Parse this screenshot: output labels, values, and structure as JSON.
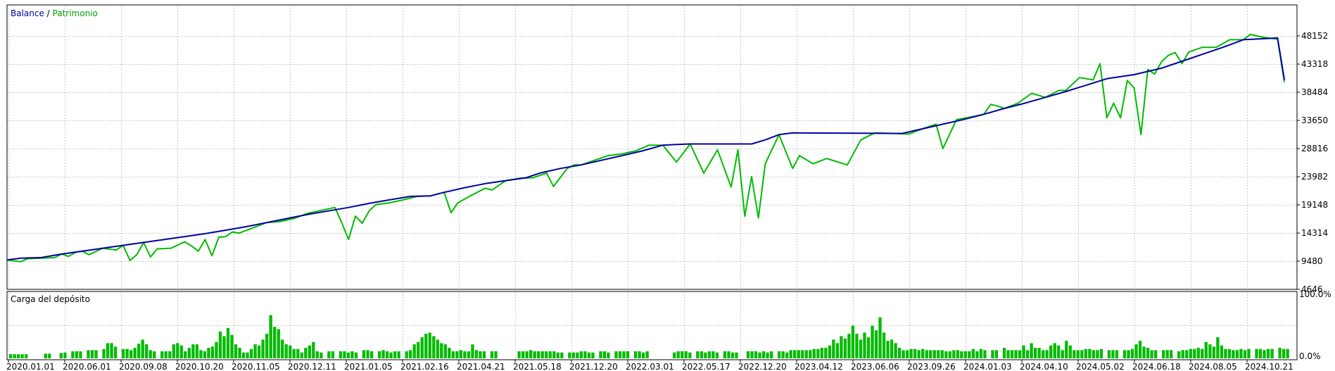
{
  "colors": {
    "balance": "#0000A0",
    "equity": "#00BB00",
    "bars": "#00BB00",
    "grid": "#C8C8C8",
    "frame": "#000000"
  },
  "legend": {
    "balance": "Balance",
    "separator": " / ",
    "equity": "Patrimonio"
  },
  "subchart": {
    "title": "Carga del depósito"
  },
  "chart_data": [
    {
      "type": "line",
      "grid": true,
      "y_ticks": [
        "48152",
        "43318",
        "38484",
        "33650",
        "28816",
        "23982",
        "19148",
        "14314",
        "9480",
        "4646"
      ],
      "ylim": [
        4646,
        48152
      ],
      "series": [
        {
          "name": "Balance",
          "color": "#0000A0",
          "values": [
            [
              0,
              9700
            ],
            [
              4,
              10000
            ],
            [
              10,
              10100
            ],
            [
              16,
              10700
            ],
            [
              22,
              11200
            ],
            [
              28,
              11700
            ],
            [
              34,
              12200
            ],
            [
              40,
              12700
            ],
            [
              46,
              13200
            ],
            [
              52,
              13700
            ],
            [
              58,
              14200
            ],
            [
              64,
              14800
            ],
            [
              70,
              15400
            ],
            [
              76,
              16100
            ],
            [
              82,
              16800
            ],
            [
              88,
              17500
            ],
            [
              94,
              18100
            ],
            [
              100,
              18700
            ],
            [
              106,
              19400
            ],
            [
              112,
              20000
            ],
            [
              118,
              20600
            ],
            [
              124,
              20700
            ],
            [
              128,
              21300
            ],
            [
              134,
              22100
            ],
            [
              140,
              22800
            ],
            [
              146,
              23300
            ],
            [
              152,
              23800
            ],
            [
              156,
              24600
            ],
            [
              162,
              25400
            ],
            [
              168,
              26000
            ],
            [
              174,
              26800
            ],
            [
              180,
              27600
            ],
            [
              186,
              28400
            ],
            [
              192,
              29400
            ],
            [
              196,
              29500
            ],
            [
              200,
              29600
            ],
            [
              218,
              29600
            ],
            [
              222,
              30300
            ],
            [
              226,
              31200
            ],
            [
              230,
              31500
            ],
            [
              262,
              31400
            ],
            [
              268,
              32200
            ],
            [
              274,
              33000
            ],
            [
              280,
              33800
            ],
            [
              286,
              34700
            ],
            [
              292,
              35700
            ],
            [
              298,
              36600
            ],
            [
              304,
              37600
            ],
            [
              310,
              38600
            ],
            [
              316,
              39700
            ],
            [
              322,
              40800
            ],
            [
              330,
              41500
            ],
            [
              338,
              42600
            ],
            [
              344,
              43800
            ],
            [
              350,
              45000
            ],
            [
              356,
              46200
            ],
            [
              362,
              47500
            ],
            [
              372,
              47800
            ],
            [
              374,
              40600
            ]
          ]
        },
        {
          "name": "Patrimonio",
          "color": "#00BB00",
          "values": [
            [
              0,
              9700
            ],
            [
              4,
              9400
            ],
            [
              6,
              9900
            ],
            [
              10,
              10000
            ],
            [
              14,
              10100
            ],
            [
              16,
              10700
            ],
            [
              18,
              10300
            ],
            [
              20,
              11000
            ],
            [
              22,
              11200
            ],
            [
              24,
              10600
            ],
            [
              28,
              11700
            ],
            [
              32,
              11400
            ],
            [
              34,
              12200
            ],
            [
              36,
              9600
            ],
            [
              38,
              10600
            ],
            [
              40,
              12700
            ],
            [
              42,
              10200
            ],
            [
              44,
              11600
            ],
            [
              48,
              11700
            ],
            [
              52,
              12800
            ],
            [
              54,
              12100
            ],
            [
              56,
              11200
            ],
            [
              58,
              13200
            ],
            [
              60,
              10400
            ],
            [
              62,
              13600
            ],
            [
              64,
              13700
            ],
            [
              66,
              14500
            ],
            [
              68,
              14300
            ],
            [
              72,
              15200
            ],
            [
              76,
              16100
            ],
            [
              80,
              16300
            ],
            [
              84,
              16800
            ],
            [
              88,
              17700
            ],
            [
              92,
              18200
            ],
            [
              96,
              18700
            ],
            [
              98,
              16100
            ],
            [
              100,
              13200
            ],
            [
              102,
              17200
            ],
            [
              104,
              16000
            ],
            [
              106,
              18100
            ],
            [
              108,
              19200
            ],
            [
              112,
              19500
            ],
            [
              116,
              20000
            ],
            [
              120,
              20600
            ],
            [
              124,
              20700
            ],
            [
              128,
              21300
            ],
            [
              130,
              17800
            ],
            [
              132,
              19500
            ],
            [
              136,
              20800
            ],
            [
              140,
              22000
            ],
            [
              142,
              21700
            ],
            [
              146,
              23300
            ],
            [
              150,
              23700
            ],
            [
              154,
              23800
            ],
            [
              158,
              24600
            ],
            [
              160,
              22300
            ],
            [
              164,
              25400
            ],
            [
              166,
              26000
            ],
            [
              168,
              26000
            ],
            [
              172,
              26800
            ],
            [
              176,
              27600
            ],
            [
              180,
              27900
            ],
            [
              184,
              28400
            ],
            [
              188,
              29400
            ],
            [
              192,
              29400
            ],
            [
              196,
              26500
            ],
            [
              200,
              29600
            ],
            [
              204,
              24600
            ],
            [
              208,
              28600
            ],
            [
              212,
              22200
            ],
            [
              214,
              28600
            ],
            [
              216,
              17200
            ],
            [
              218,
              24000
            ],
            [
              220,
              16900
            ],
            [
              222,
              26200
            ],
            [
              226,
              31200
            ],
            [
              230,
              25400
            ],
            [
              232,
              27600
            ],
            [
              236,
              26200
            ],
            [
              240,
              27100
            ],
            [
              246,
              26000
            ],
            [
              250,
              30300
            ],
            [
              254,
              31500
            ],
            [
              260,
              31400
            ],
            [
              264,
              31300
            ],
            [
              268,
              32200
            ],
            [
              272,
              33000
            ],
            [
              274,
              28800
            ],
            [
              278,
              33800
            ],
            [
              282,
              34200
            ],
            [
              286,
              34700
            ],
            [
              288,
              36400
            ],
            [
              290,
              36100
            ],
            [
              292,
              35700
            ],
            [
              296,
              36600
            ],
            [
              300,
              38300
            ],
            [
              304,
              37600
            ],
            [
              308,
              38800
            ],
            [
              310,
              38800
            ],
            [
              314,
              41000
            ],
            [
              318,
              40600
            ],
            [
              320,
              43400
            ],
            [
              322,
              34100
            ],
            [
              324,
              36600
            ],
            [
              326,
              34100
            ],
            [
              328,
              40500
            ],
            [
              330,
              39200
            ],
            [
              332,
              31200
            ],
            [
              334,
              42400
            ],
            [
              336,
              41600
            ],
            [
              338,
              43700
            ],
            [
              340,
              44800
            ],
            [
              342,
              45300
            ],
            [
              344,
              43400
            ],
            [
              346,
              45400
            ],
            [
              350,
              46200
            ],
            [
              354,
              46200
            ],
            [
              358,
              47500
            ],
            [
              362,
              47500
            ],
            [
              364,
              48400
            ],
            [
              368,
              47900
            ],
            [
              372,
              47600
            ],
            [
              374,
              40200
            ]
          ]
        }
      ],
      "x_max": 375
    },
    {
      "type": "bar",
      "title": "Carga del depósito",
      "y_ticks": [
        "100.0%",
        "0.0%"
      ],
      "ylim": [
        0,
        100
      ],
      "values": [
        7,
        7,
        7,
        7,
        7,
        0,
        0,
        0,
        0,
        8,
        8,
        0,
        0,
        9,
        10,
        0,
        12,
        12,
        12,
        0,
        14,
        14,
        14,
        0,
        16,
        26,
        26,
        20,
        0,
        16,
        16,
        14,
        18,
        25,
        32,
        24,
        14,
        12,
        0,
        12,
        12,
        12,
        24,
        26,
        22,
        12,
        18,
        24,
        24,
        14,
        12,
        18,
        20,
        28,
        46,
        38,
        52,
        40,
        24,
        18,
        10,
        10,
        16,
        24,
        22,
        32,
        42,
        74,
        54,
        50,
        32,
        24,
        22,
        16,
        16,
        10,
        18,
        22,
        28,
        12,
        10,
        0,
        12,
        12,
        0,
        12,
        12,
        10,
        12,
        10,
        0,
        14,
        14,
        12,
        0,
        12,
        14,
        12,
        10,
        12,
        12,
        0,
        12,
        14,
        24,
        28,
        36,
        42,
        44,
        38,
        32,
        26,
        24,
        18,
        12,
        12,
        14,
        12,
        12,
        24,
        14,
        12,
        12,
        0,
        12,
        12,
        0,
        0,
        0,
        0,
        0,
        12,
        12,
        12,
        14,
        12,
        12,
        12,
        12,
        12,
        12,
        10,
        10,
        0,
        10,
        10,
        10,
        12,
        12,
        10,
        10,
        0,
        12,
        12,
        10,
        0,
        12,
        12,
        12,
        12,
        0,
        12,
        12,
        10,
        12,
        0,
        0,
        0,
        0,
        0,
        0,
        10,
        12,
        12,
        12,
        10,
        0,
        12,
        12,
        10,
        12,
        12,
        10,
        0,
        12,
        12,
        10,
        10,
        0,
        0,
        12,
        12,
        12,
        10,
        12,
        10,
        12,
        0,
        12,
        12,
        10,
        14,
        14,
        14,
        14,
        14,
        14,
        16,
        16,
        18,
        18,
        22,
        32,
        26,
        38,
        34,
        42,
        56,
        42,
        32,
        44,
        36,
        56,
        48,
        70,
        44,
        30,
        32,
        26,
        18,
        14,
        14,
        16,
        16,
        14,
        16,
        14,
        14,
        14,
        14,
        14,
        12,
        12,
        14,
        14,
        12,
        12,
        12,
        16,
        12,
        16,
        14,
        0,
        14,
        14,
        0,
        18,
        14,
        14,
        14,
        14,
        22,
        14,
        26,
        18,
        18,
        14,
        14,
        22,
        26,
        22,
        14,
        30,
        22,
        14,
        14,
        14,
        16,
        16,
        14,
        14,
        16,
        0,
        14,
        14,
        14,
        0,
        14,
        14,
        16,
        24,
        30,
        20,
        18,
        14,
        14,
        0,
        14,
        14,
        14,
        0,
        12,
        14,
        14,
        16,
        16,
        18,
        16,
        28,
        24,
        20,
        36,
        22,
        16,
        16,
        14,
        14,
        16,
        14,
        16,
        0,
        16,
        16,
        14,
        16,
        16,
        0,
        18,
        16,
        16
      ]
    }
  ],
  "x_axis_labels": [
    "2020.01.01",
    "2020.06.01",
    "2020.09.08",
    "2020.10.20",
    "2020.11.05",
    "2020.12.11",
    "2021.01.05",
    "2021.02.16",
    "2021.04.21",
    "2021.05.18",
    "2021.12.20",
    "2022.03.01",
    "2022.05.17",
    "2022.12.20",
    "2023.04.12",
    "2023.06.06",
    "2023.09.26",
    "2024.01.03",
    "2024.04.10",
    "2024.05.02",
    "2024.06.18",
    "2024.08.05",
    "2024.10.21"
  ]
}
